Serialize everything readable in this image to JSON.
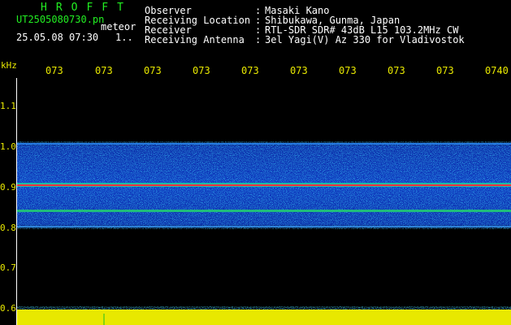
{
  "header": {
    "brand": "HROFFT",
    "filename": "UT2505080730.pn",
    "mode": "meteor",
    "datetime": "25.05.08 07:30",
    "count": "1..",
    "info": [
      {
        "label": "Observer",
        "value": "Masaki Kano"
      },
      {
        "label": "Receiving Location",
        "value": "Shibukawa, Gunma, Japan"
      },
      {
        "label": "Receiver",
        "value": "RTL-SDR SDR# 43dB L15 103.2MHz CW"
      },
      {
        "label": "Receiving Antenna",
        "value": "3el Yagi(V) Az 330 for Vladivostok"
      }
    ]
  },
  "axes": {
    "y_unit": "kHz",
    "y_ticks": [
      "1.1",
      "1.0",
      "0.9",
      "0.8",
      "0.7",
      "0.6"
    ],
    "x_ticks": [
      "073",
      "073",
      "073",
      "073",
      "073",
      "073",
      "073",
      "073",
      "073",
      "0740"
    ]
  },
  "colors": {
    "text": "#ffffff",
    "brand": "#22ee22",
    "axis": "#e8e800",
    "background": "#000000"
  }
}
